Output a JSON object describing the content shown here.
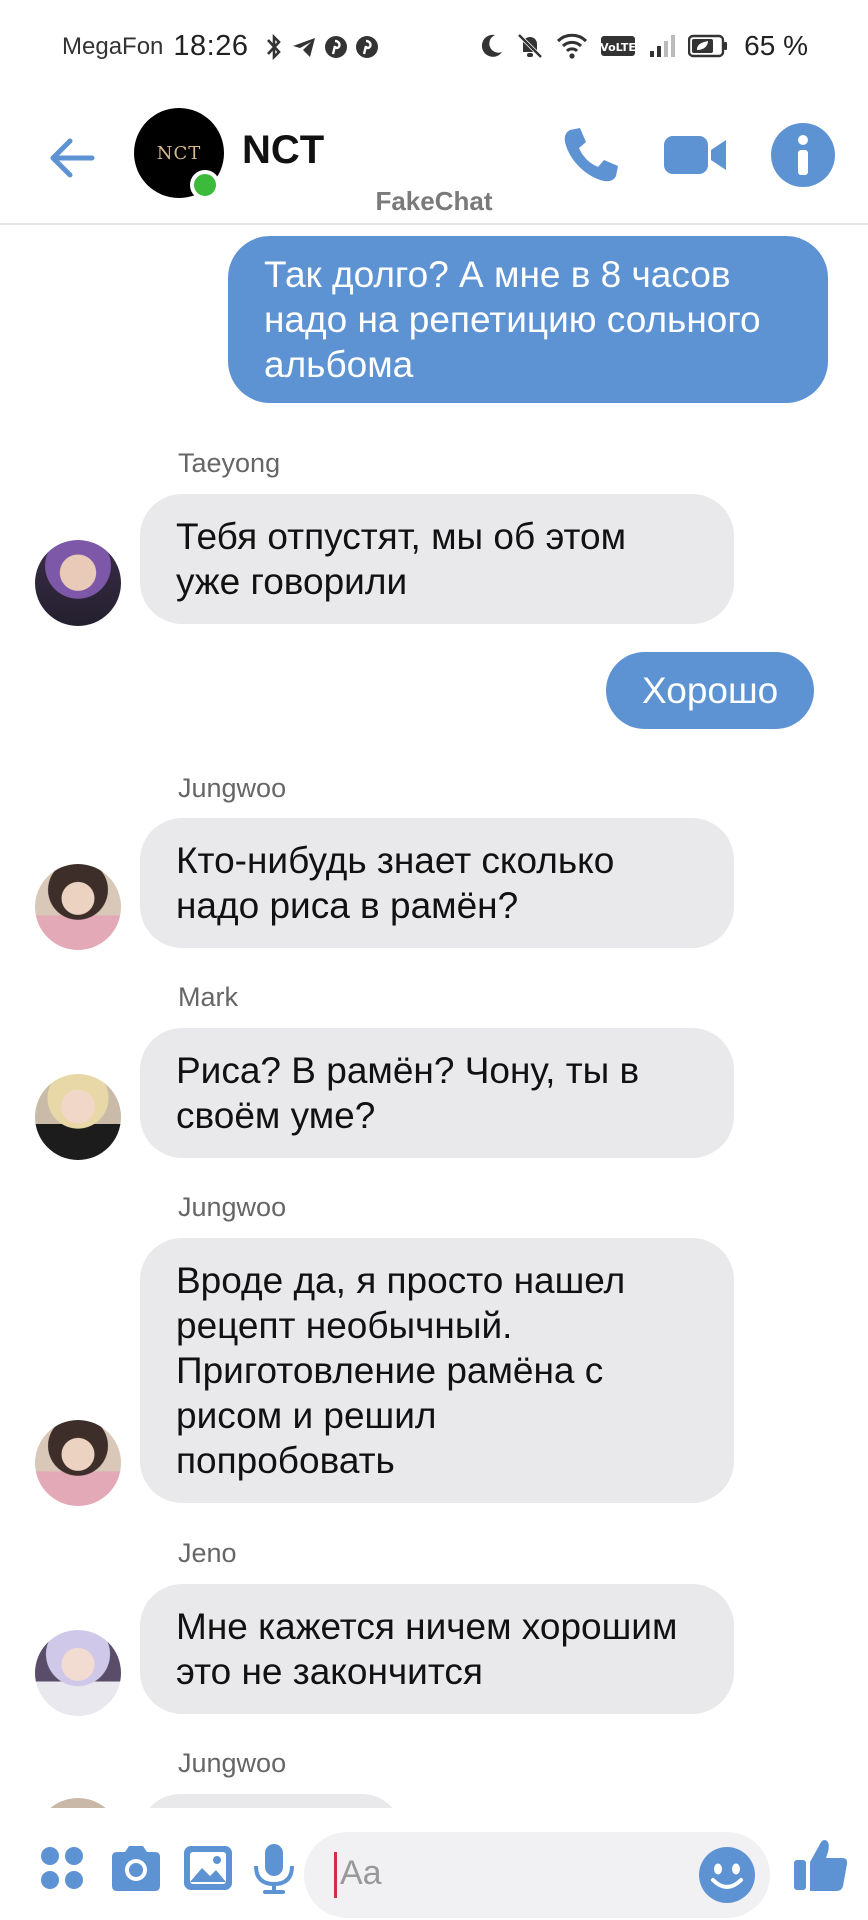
{
  "status_bar": {
    "carrier": "MegaFon",
    "time": "18:26",
    "battery": "65 %"
  },
  "header": {
    "title": "NCT",
    "avatar_logo": "NCT",
    "watermark": "FakeChat",
    "icons": [
      "back-arrow-icon",
      "phone-icon",
      "video-camera-icon",
      "info-icon"
    ],
    "accent_color": "#5e93d3"
  },
  "messages": [
    {
      "direction": "out",
      "text": "Так долго? А мне в 8 часов надо на репетицию сольного альбома"
    },
    {
      "direction": "in",
      "sender": "Taeyong",
      "text": "Тебя отпустят, мы об этом уже говорили"
    },
    {
      "direction": "out",
      "text": "Хорошо"
    },
    {
      "direction": "in",
      "sender": "Jungwoo",
      "text": "Кто-нибудь знает сколько надо риса в рамён?"
    },
    {
      "direction": "in",
      "sender": "Mark",
      "text": "Риса? В рамён? Чону, ты в своём уме?"
    },
    {
      "direction": "in",
      "sender": "Jungwoo",
      "text": "Вроде да, я просто нашел рецепт необычный. Приготовление рамёна с рисом и решил попробовать"
    },
    {
      "direction": "in",
      "sender": "Jeno",
      "text": "Мне кажется ничем хорошим это не закончится"
    },
    {
      "direction": "in",
      "sender": "Jungwoo",
      "text": ""
    }
  ],
  "composer": {
    "placeholder": "Aa",
    "icons": [
      "apps-grid-icon",
      "camera-icon",
      "gallery-image-icon",
      "microphone-icon",
      "emoji-icon",
      "thumbs-up-icon"
    ]
  }
}
